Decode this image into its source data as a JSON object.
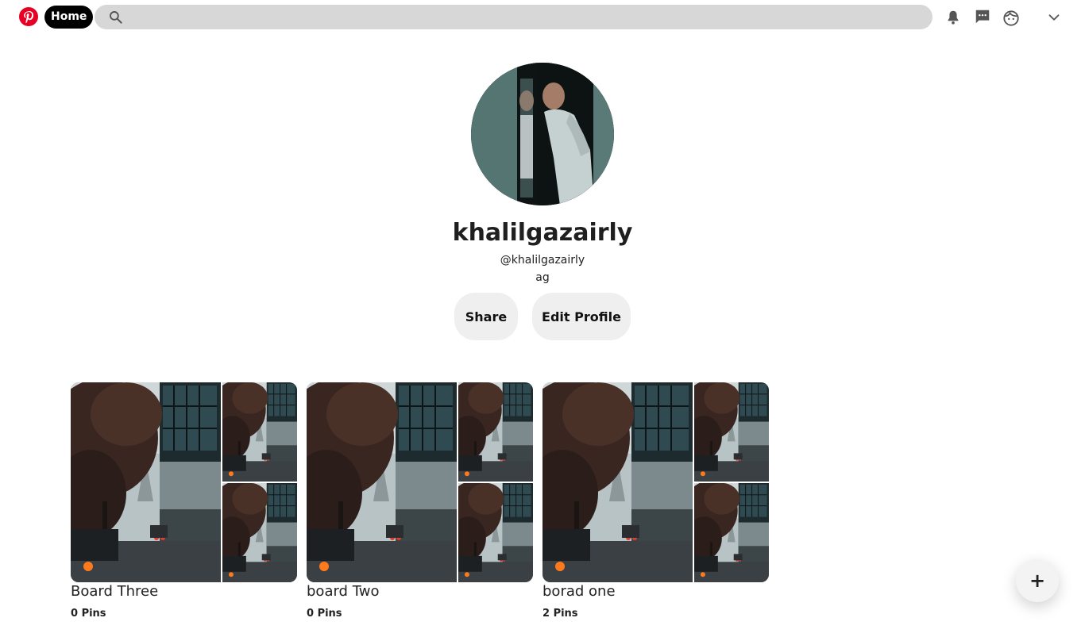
{
  "nav": {
    "home_label": "Home",
    "search_placeholder": ""
  },
  "profile": {
    "name": "khalilgazairly",
    "handle": "@khalilgazairly",
    "bio": "ag",
    "share_label": "Share",
    "edit_label": "Edit Profile"
  },
  "boards": [
    {
      "title": "Board Three",
      "pins": "0 Pins"
    },
    {
      "title": "board Two",
      "pins": "0 Pins"
    },
    {
      "title": "borad one",
      "pins": "2 Pins"
    }
  ],
  "fab_label": "+",
  "colors": {
    "brand_red": "#e60023",
    "search_bg": "#d7d7d7",
    "button_bg": "#efefef",
    "home_pill_bg": "#000000"
  },
  "icons": [
    "pinterest-logo-icon",
    "search-icon",
    "bell-icon",
    "message-icon",
    "profile-face-icon",
    "chevron-down-icon",
    "plus-icon"
  ]
}
